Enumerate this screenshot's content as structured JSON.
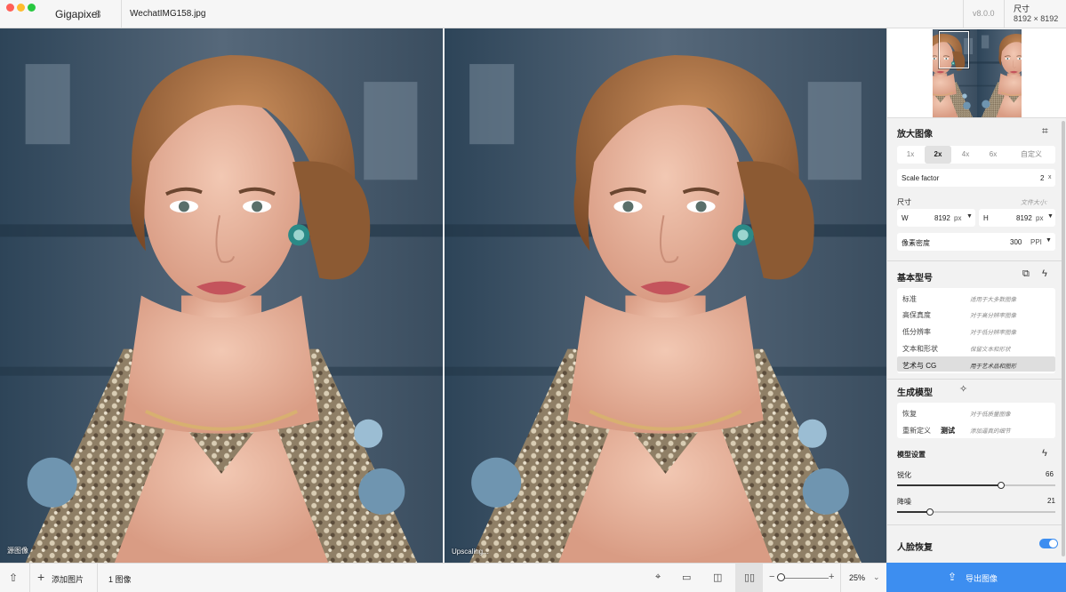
{
  "app": {
    "name": "Gigapixel",
    "version_badge": "8",
    "file_name": "WechatIMG158.jpg",
    "app_version": "v8.0.0"
  },
  "header": {
    "dimensions_label": "尺寸",
    "dimensions_value": "8192 × 8192"
  },
  "panes": {
    "left_caption": "源图像",
    "right_caption": "Upscaling..."
  },
  "upscale": {
    "title": "放大图像",
    "scale_options": [
      "1x",
      "2x",
      "4x",
      "6x",
      "自定义"
    ],
    "selected_scale": "2x",
    "scale_factor_label": "Scale factor",
    "scale_factor_value": "2",
    "scale_factor_unit": "x"
  },
  "size": {
    "label": "尺寸",
    "file_size_label": "文件大小:",
    "w_label": "W",
    "w_value": "8192",
    "w_unit": "px",
    "h_label": "H",
    "h_value": "8192",
    "h_unit": "px",
    "ppi_label": "像素密度",
    "ppi_value": "300",
    "ppi_unit": "PPI"
  },
  "base_models": {
    "title": "基本型号",
    "items": [
      {
        "name": "标准",
        "desc": "适用于大多数图像"
      },
      {
        "name": "高保真度",
        "desc": "对于高分辨率图像"
      },
      {
        "name": "低分辨率",
        "desc": "对于低分辨率图像"
      },
      {
        "name": "文本和形状",
        "desc": "保留文本和形状"
      },
      {
        "name": "艺术与 CG",
        "desc": "用于艺术品和图形"
      }
    ],
    "selected_index": 4
  },
  "gen_models": {
    "title": "生成模型",
    "items": [
      {
        "name": "恢复",
        "desc": "对于低质量图像"
      },
      {
        "name": "重新定义",
        "badge": "测试",
        "desc": "添加逼真的细节"
      }
    ]
  },
  "model_settings": {
    "title": "模型设置",
    "sharpen_label": "锐化",
    "sharpen_value": "66",
    "denoise_label": "降噪",
    "denoise_value": "21"
  },
  "face_recovery": {
    "label": "人脸恢复",
    "enabled": true
  },
  "bottom": {
    "add_image": "添加图片",
    "image_count": "1 图像",
    "zoom": "25%"
  },
  "export": {
    "label": "导出图像"
  },
  "icons": {
    "upload": "upload-icon",
    "plus": "plus-icon",
    "crop": "crop-icon",
    "compare": "compare-icon",
    "bolt": "bolt-icon",
    "wand": "wand-icon"
  },
  "colors": {
    "accent": "#3d8ef0",
    "selected_row": "#dedede"
  }
}
